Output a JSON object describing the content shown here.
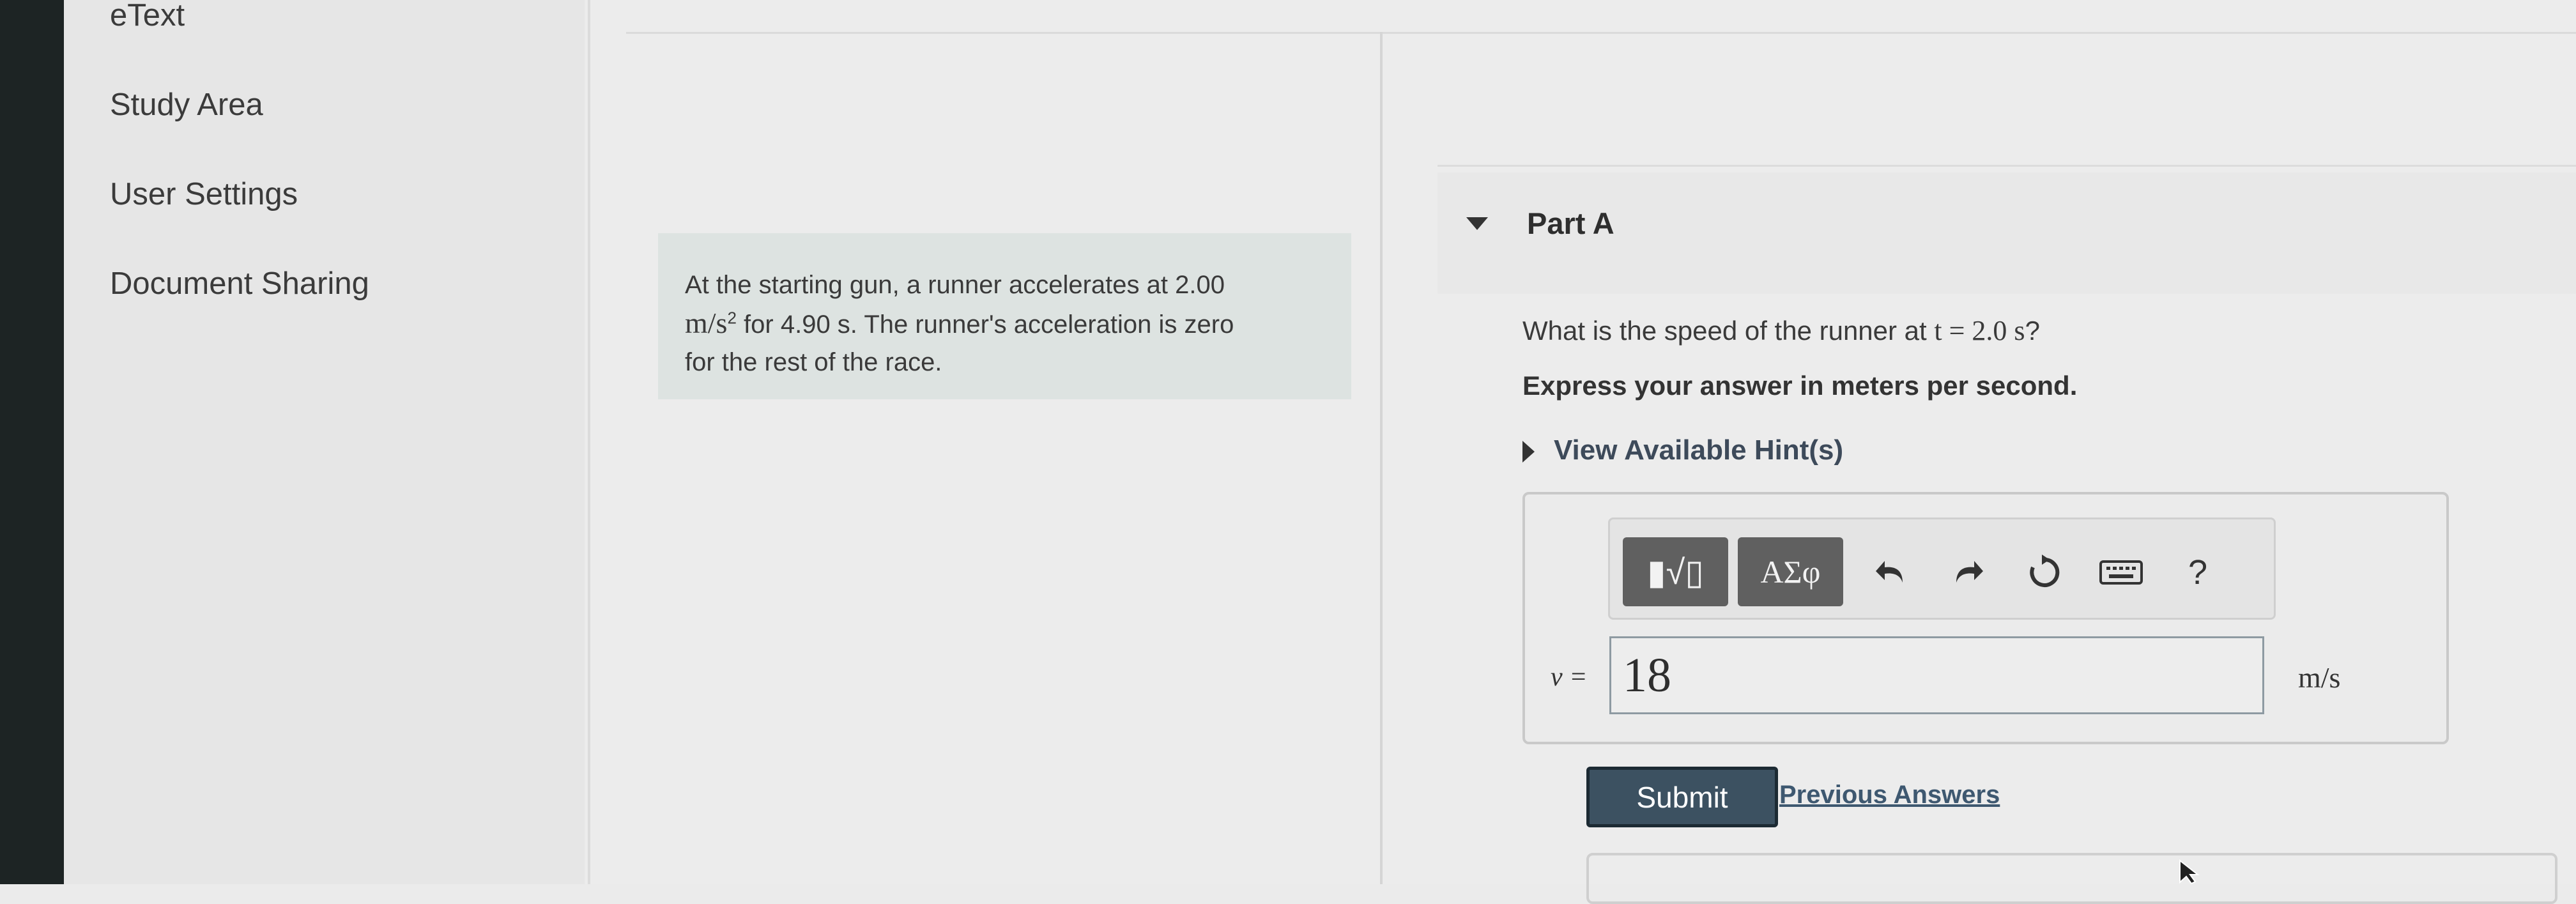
{
  "nav": {
    "items": [
      {
        "label": "eText"
      },
      {
        "label": "Study Area"
      },
      {
        "label": "User Settings"
      },
      {
        "label": "Document Sharing"
      }
    ]
  },
  "problem": {
    "line1": "At the starting gun, a runner accelerates at 2.00",
    "unit_math": "m/s",
    "unit_exp": "2",
    "line2_rest": " for 4.90 s. The runner's acceleration is zero",
    "line3": "for the rest of the race."
  },
  "part_a": {
    "title": "Part A",
    "question_prefix": "What is the speed of the runner at ",
    "question_math": "t = 2.0 s",
    "question_suffix": "?",
    "instruction": "Express your answer in meters per second.",
    "hint_label": "View Available Hint(s)"
  },
  "answer": {
    "toolbar": {
      "template_icon": "fraction-root-template-icon",
      "template_label": "▮√▯",
      "greek_label": "ΑΣφ",
      "help_label": "?"
    },
    "variable": "v =",
    "value": "18",
    "unit": "m/s"
  },
  "actions": {
    "submit_label": "Submit",
    "previous_label": "Previous Answers"
  },
  "colors": {
    "submit_bg": "#3c5161",
    "problem_bg": "#dde3e1",
    "link": "#3e5870"
  }
}
